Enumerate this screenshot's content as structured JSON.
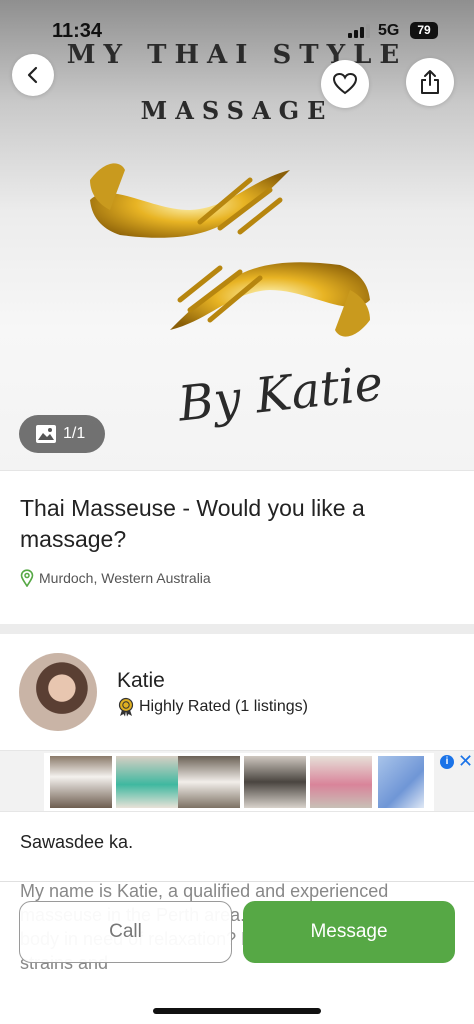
{
  "status_bar": {
    "time": "11:34",
    "network": "5G",
    "battery": "79"
  },
  "hero": {
    "logo_line1": "MY THAI STYLE",
    "logo_line2": "MASSAGE",
    "logo_signature": "By Katie",
    "photo_count": "1/1"
  },
  "listing": {
    "title": "Thai Masseuse - Would you like a massage?",
    "location": "Murdoch, Western Australia"
  },
  "seller": {
    "name": "Katie",
    "rating": "Highly Rated (1 listings)"
  },
  "description": {
    "greeting": "Sawasdee ka.",
    "body": "My name is Katie, a qualified and experienced masseuse in the Perth area. Are you feeling tired, or body in need of relaxation? Let me ease your daily strains and"
  },
  "actions": {
    "call_label": "Call",
    "message_label": "Message"
  },
  "ad": {
    "info_label": "i",
    "close_label": "✕"
  },
  "colors": {
    "accent_green": "#56a845",
    "gold": "#d4a21a"
  },
  "icons": [
    "back-icon",
    "heart-icon",
    "share-icon",
    "image-icon",
    "location-pin-icon",
    "award-icon"
  ]
}
